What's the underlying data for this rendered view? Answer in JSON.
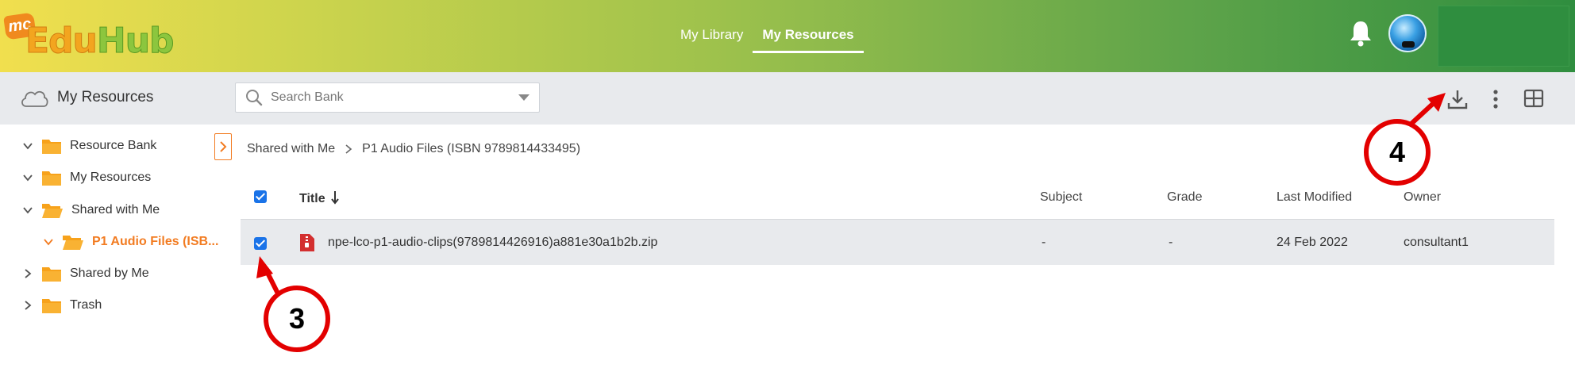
{
  "app": {
    "logo_mc": "mc",
    "logo_edu": "Edu",
    "logo_hub": "Hub"
  },
  "topnav": {
    "tabs": [
      {
        "label": "My Library"
      },
      {
        "label": "My Resources",
        "active": true
      }
    ]
  },
  "toolbar": {
    "title": "My Resources",
    "search_placeholder": "Search Bank"
  },
  "sidebar": {
    "items": [
      {
        "label": "Resource Bank"
      },
      {
        "label": "My Resources"
      },
      {
        "label": "Shared with Me"
      },
      {
        "label": "P1 Audio Files (ISB..."
      },
      {
        "label": "Shared by Me"
      },
      {
        "label": "Trash"
      }
    ]
  },
  "breadcrumb": {
    "items": [
      "Shared with Me",
      "P1 Audio Files (ISBN 9789814433495)"
    ]
  },
  "table": {
    "headers": {
      "title": "Title",
      "subject": "Subject",
      "grade": "Grade",
      "modified": "Last Modified",
      "owner": "Owner"
    },
    "rows": [
      {
        "title": "npe-lco-p1-audio-clips(9789814426916)a881e30a1b2b.zip",
        "subject": "-",
        "grade": "-",
        "modified": "24 Feb 2022",
        "owner": "consultant1"
      }
    ]
  },
  "callouts": {
    "step3": "3",
    "step4": "4"
  },
  "colors": {
    "accent": "#f27c22",
    "checkbox": "#1a73e8",
    "callout": "#e30000"
  }
}
